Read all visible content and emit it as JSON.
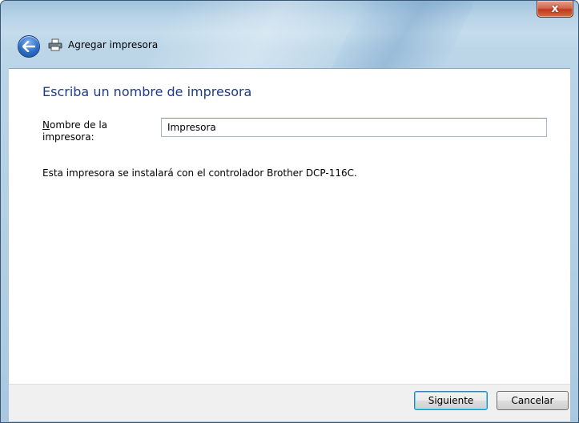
{
  "window": {
    "close_label": "x"
  },
  "titlebar": {
    "title": "Agregar impresora"
  },
  "main": {
    "heading": "Escriba un nombre de impresora",
    "field_label_first": "N",
    "field_label_rest_line1": "ombre de la",
    "field_label_line2": "impresora:",
    "printer_name_value": "Impresora",
    "info": "Esta impresora se instalará con el controlador Brother DCP-116C."
  },
  "footer": {
    "next_label": "Siguiente",
    "cancel_label": "Cancelar"
  },
  "colors": {
    "heading": "#1e3b8a",
    "default_button_border": "#3c7fb1"
  },
  "icons": [
    "back-arrow-icon",
    "printer-icon",
    "close-icon"
  ]
}
